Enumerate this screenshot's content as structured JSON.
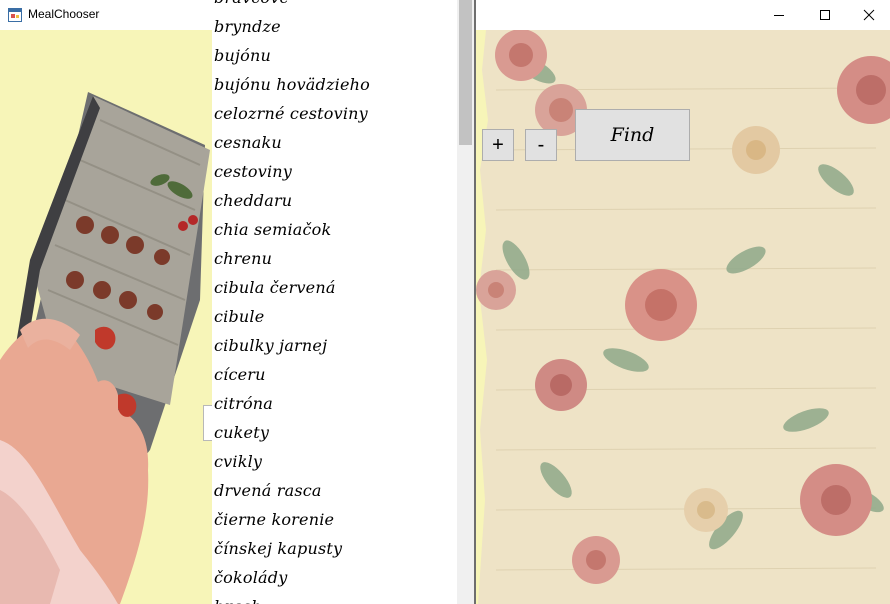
{
  "window": {
    "title": "MealChooser",
    "icon": "app-window-icon",
    "controls": [
      "minimize-icon",
      "maximize-icon",
      "close-icon"
    ]
  },
  "ingredients": {
    "items": [
      "bravčové",
      "bryndze",
      "bujónu",
      "bujónu hovädzieho",
      "celozrné cestoviny",
      "cesnaku",
      "cestoviny",
      "cheddaru",
      "chia semiačok",
      "chrenu",
      "cibula červená",
      "cibule",
      "cibulky jarnej",
      "cíceru",
      "citróna",
      "cukety",
      "cvikly",
      "drvená rasca",
      "čierne korenie",
      "čínskej kapusty",
      "čokolády",
      "hrach"
    ]
  },
  "controls": {
    "add_label": "+",
    "remove_label": "-",
    "find_label": "Find"
  },
  "colors": {
    "left_background": "#f7f5b8",
    "right_background": "#eee3c6",
    "button_face": "#e1e1e1"
  },
  "images": {
    "left": "cookbook-illustration",
    "right": "floral-wallpaper"
  }
}
